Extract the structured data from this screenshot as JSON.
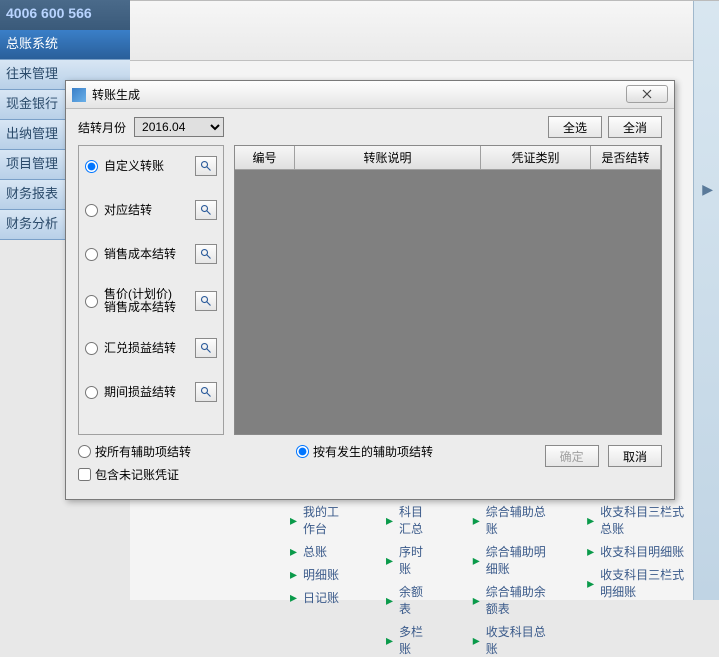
{
  "top_text": "4006 600 566",
  "sidebar": {
    "items": [
      {
        "label": "总账系统",
        "active": true
      },
      {
        "label": "往来管理",
        "active": false
      },
      {
        "label": "现金银行",
        "active": false
      },
      {
        "label": "出纳管理",
        "active": false
      },
      {
        "label": "项目管理",
        "active": false
      },
      {
        "label": "财务报表",
        "active": false
      },
      {
        "label": "财务分析",
        "active": false
      }
    ]
  },
  "dialog": {
    "title": "转账生成",
    "period_label": "结转月份",
    "period_value": "2016.04",
    "btn_select_all": "全选",
    "btn_deselect_all": "全消",
    "radios": {
      "r1": "自定义转账",
      "r2": "对应结转",
      "r3": "销售成本结转",
      "r4": "售价(计划价)\n销售成本结转",
      "r5": "汇兑损益结转",
      "r6": "期间损益结转"
    },
    "columns": {
      "c1": "编号",
      "c2": "转账说明",
      "c3": "凭证类别",
      "c4": "是否结转"
    },
    "foot_radio1": "按所有辅助项结转",
    "foot_radio2": "按有发生的辅助项结转",
    "foot_check": "包含未记账凭证",
    "btn_ok": "确定",
    "btn_cancel": "取消"
  },
  "bg_links": {
    "col1": [
      "我的工作台",
      "总账",
      "明细账",
      "日记账"
    ],
    "col2": [
      "科目汇总",
      "序时账",
      "余额表",
      "多栏账"
    ],
    "col3": [
      "综合辅助总账",
      "综合辅助明细账",
      "综合辅助余额表",
      "收支科目总账"
    ],
    "col4": [
      "收支科目三栏式总账",
      "收支科目明细账",
      "收支科目三栏式明细账"
    ]
  }
}
